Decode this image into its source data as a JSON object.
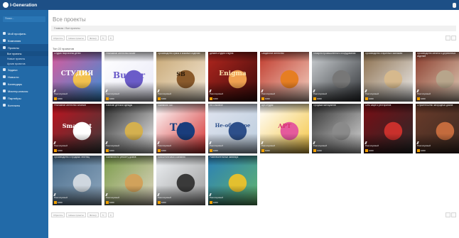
{
  "brand": {
    "name": "I-Generation",
    "accent": "#1d4f86",
    "sidebar_color": "#226aa8"
  },
  "sidebar": {
    "search_placeholder": "Поиск...",
    "items": [
      {
        "label": "Мой профиль",
        "icon": "user-icon"
      },
      {
        "label": "Компания",
        "icon": "building-icon"
      },
      {
        "label": "Проекты",
        "icon": "folder-icon",
        "active": true,
        "children": [
          "Все проекты",
          "Новые проекты",
          "Архив проектов"
        ]
      },
      {
        "label": "Задачи",
        "icon": "tasks-icon"
      },
      {
        "label": "Новости",
        "icon": "news-icon"
      },
      {
        "label": "Календарь",
        "icon": "calendar-icon"
      },
      {
        "label": "Мастер-классы",
        "icon": "class-icon"
      },
      {
        "label": "Партнёры",
        "icon": "partners-icon"
      },
      {
        "label": "Контакты",
        "icon": "contacts-icon"
      }
    ]
  },
  "main": {
    "title": "Все проекты",
    "breadcrumb": "Главная  /  Все проекты",
    "toolbar": [
      "Сбросить",
      "Новые проекты",
      "Фильтр"
    ],
    "count_label": "Топ 22 проектов"
  },
  "cards": [
    {
      "title": "Студия творчества детей",
      "status": "Реализуемый",
      "badge": "1000"
    },
    {
      "title": "Рекламное агентство Buster",
      "status": "Реализуемый",
      "badge": "1000"
    },
    {
      "title": "Производство сумок и кожаных изделий",
      "status": "Реализуемый",
      "badge": "1000"
    },
    {
      "title": "Дизайн-студия Enigma",
      "status": "Реализуемый",
      "badge": "1000"
    },
    {
      "title": "Свадебное агентство",
      "status": "Реализуемый",
      "badge": "1000"
    },
    {
      "title": "Пекарня промышленного оборудования",
      "status": "Реализуемый",
      "badge": "1000"
    },
    {
      "title": "Производство старинных экипажей",
      "status": "Реализуемый",
      "badge": "1000"
    },
    {
      "title": "Производство мебели и деревянных изделий",
      "status": "Реализуемый",
      "badge": "1000"
    },
    {
      "title": "Рекламное агентство SmartArt",
      "status": "Реализуемый",
      "badge": "1000"
    },
    {
      "title": "Магазин детской одежды",
      "status": "Реализуемый",
      "badge": "1000"
    },
    {
      "title": "Компания TAE",
      "status": "Реализуемый",
      "badge": "1000"
    },
    {
      "title": "Не-Обычное",
      "status": "Реализуемый",
      "badge": "1000"
    },
    {
      "title": "Арт-студия",
      "status": "Реализуемый",
      "badge": "1000"
    },
    {
      "title": "Продажа мотоциклов",
      "status": "Реализуемый",
      "badge": "1000"
    },
    {
      "title": "Сеть кафе и ресторанов",
      "status": "Реализуемый",
      "badge": "1000"
    },
    {
      "title": "Строительство загородных домов",
      "status": "Реализуемый",
      "badge": "1000"
    },
    {
      "title": "Производство и продажа лестниц",
      "status": "Реализуемый",
      "badge": "1000"
    },
    {
      "title": "Компания по ремонту домов",
      "status": "Реализуемый",
      "badge": "1000"
    },
    {
      "title": "Консалтинговая компания",
      "status": "Реализуемый",
      "badge": "1000"
    },
    {
      "title": "Развлекательный аквапарк",
      "status": "Реализуемый",
      "badge": "1000"
    }
  ],
  "card_labels": [
    "СТУДИЯ",
    "Buster",
    "SB",
    "Enigma",
    "SmartArt",
    "TAE",
    "Не-обычное",
    "АРТ"
  ]
}
